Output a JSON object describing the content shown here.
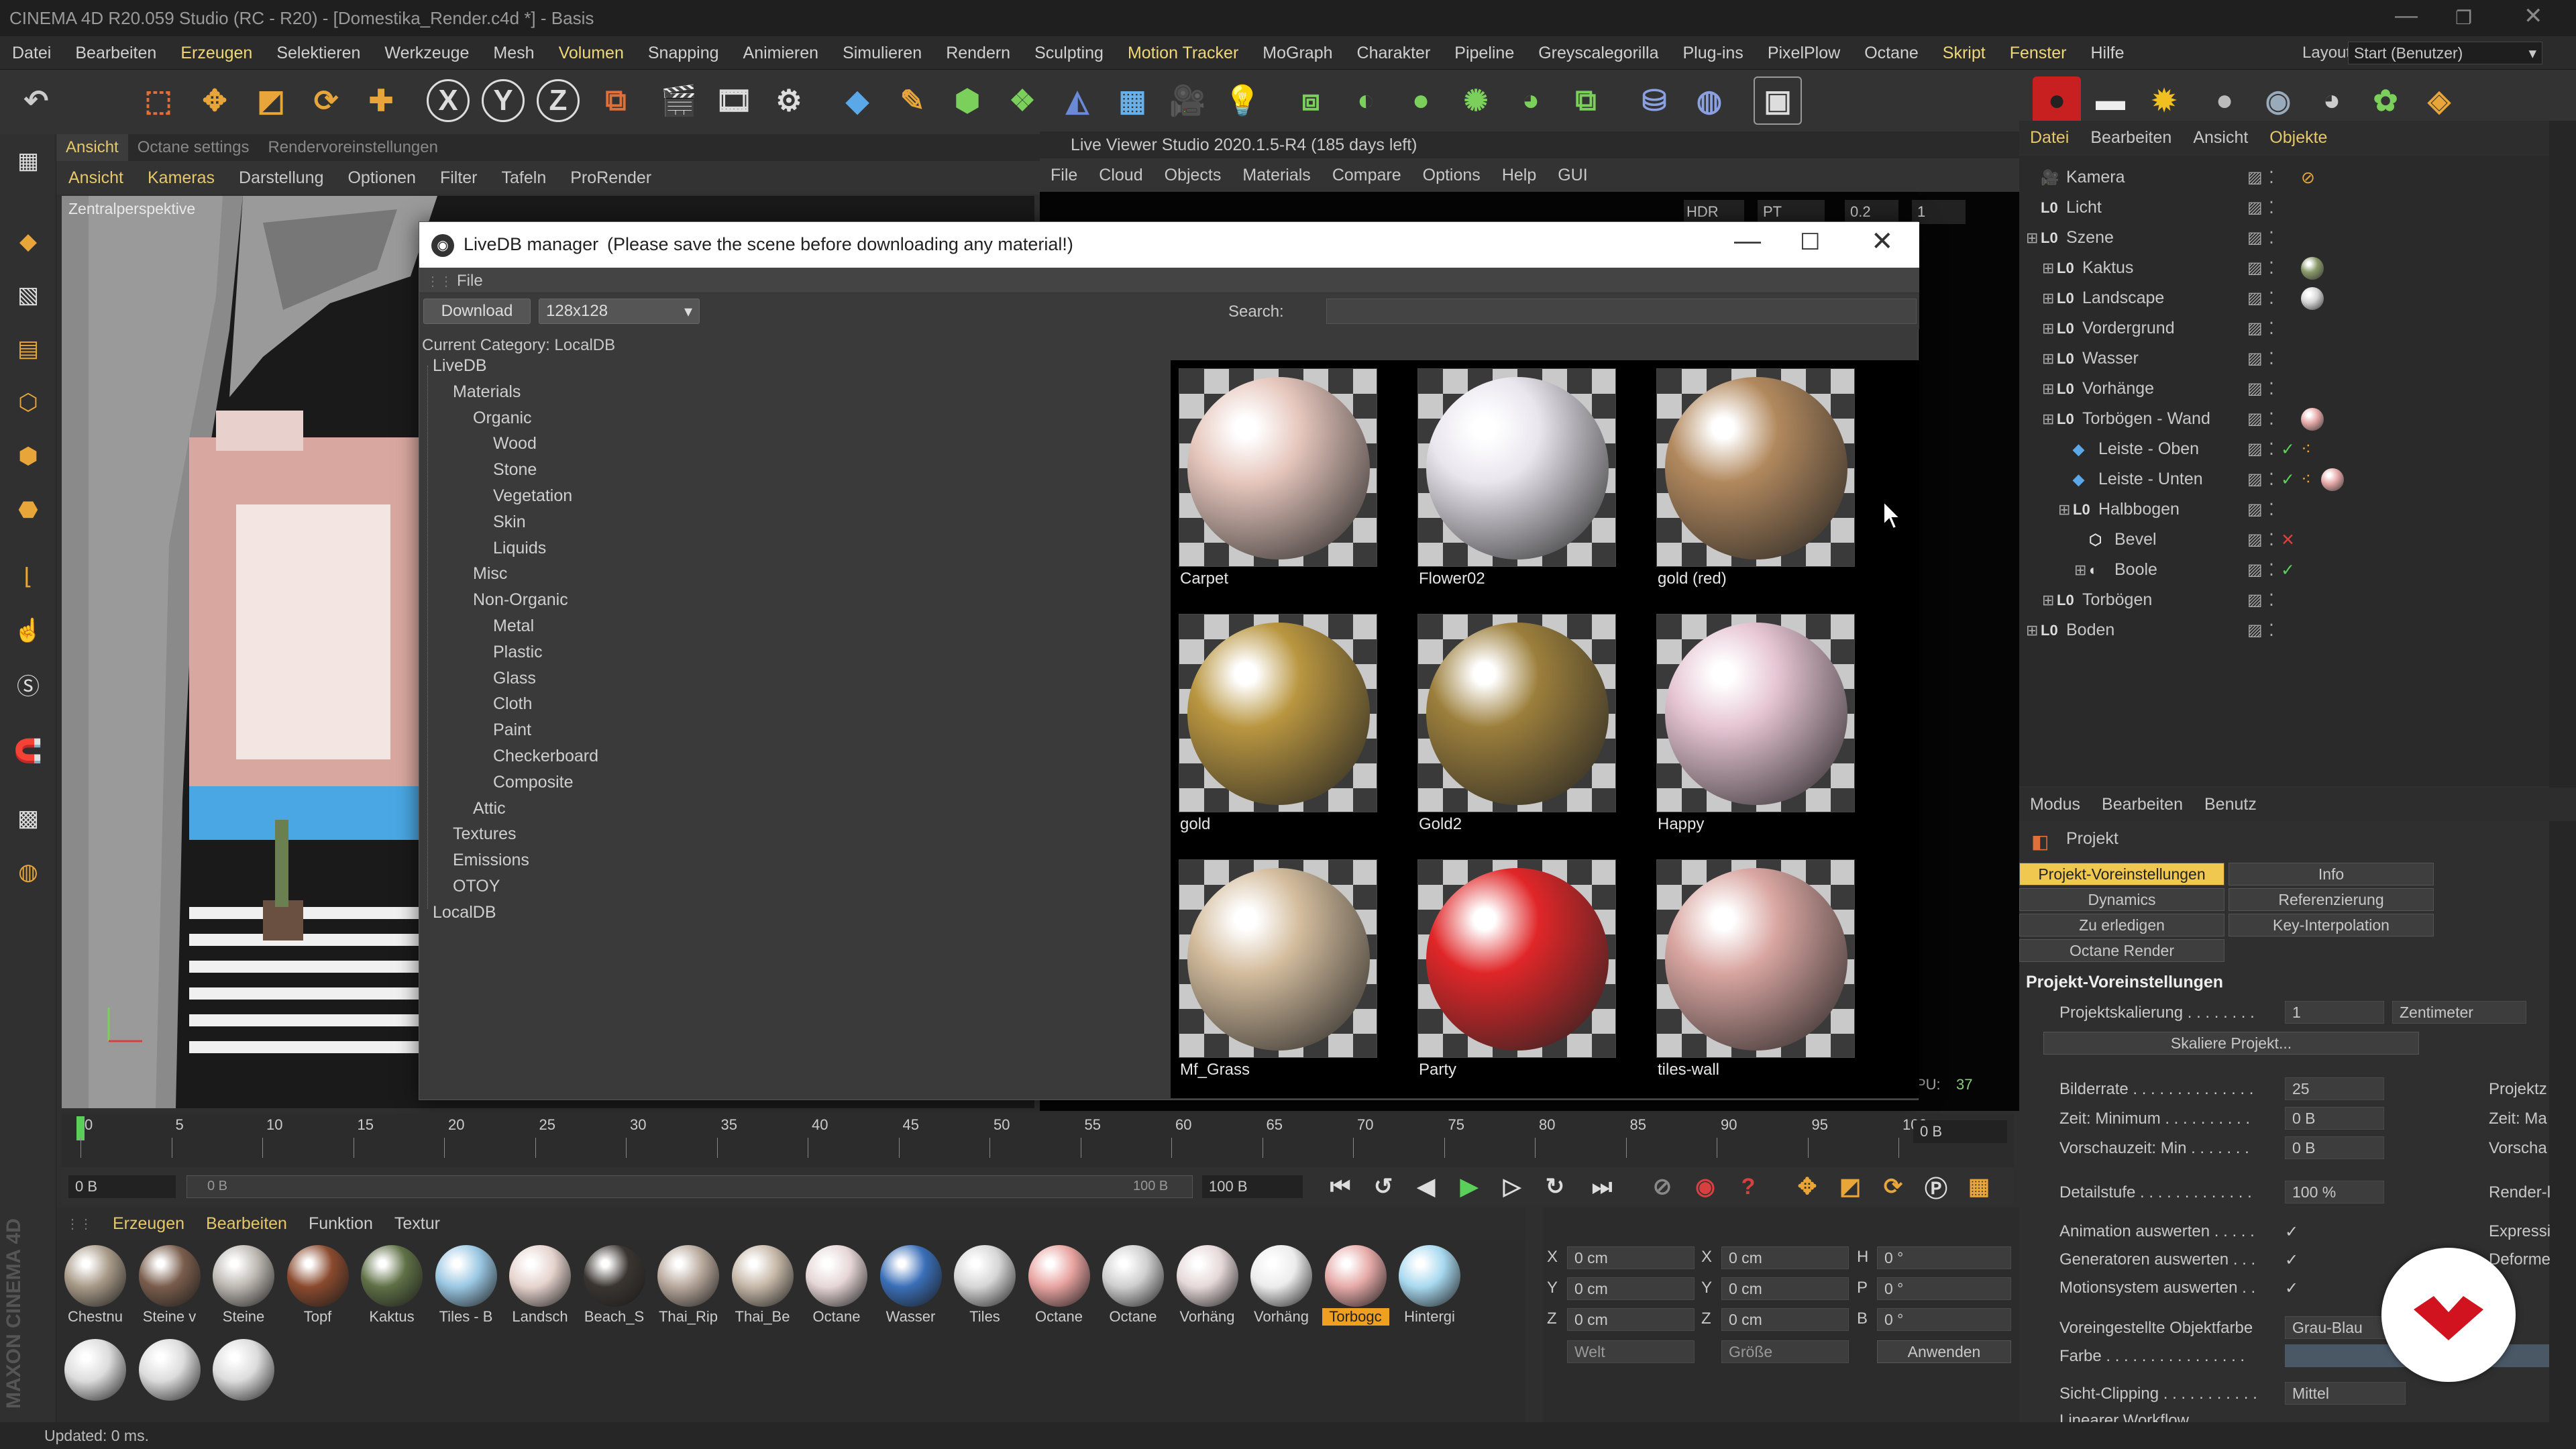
{
  "window": {
    "title": "CINEMA 4D R20.059 Studio (RC - R20) - [Domestika_Render.c4d *] - Basis",
    "layout_label": "Layout:",
    "layout_value": "Start (Benutzer)"
  },
  "menubar": [
    "Datei",
    "Bearbeiten",
    "Erzeugen",
    "Selektieren",
    "Werkzeuge",
    "Mesh",
    "Volumen",
    "Snapping",
    "Animieren",
    "Simulieren",
    "Rendern",
    "Sculpting",
    "Motion Tracker",
    "MoGraph",
    "Charakter",
    "Pipeline",
    "Greyscalegorilla",
    "Plug-ins",
    "PixelPlow",
    "Octane",
    "Skript",
    "Fenster",
    "Hilfe"
  ],
  "toolbar": {
    "x": "X",
    "y": "Y",
    "z": "Z"
  },
  "viewport": {
    "tabs": [
      "Ansicht",
      "Octane settings",
      "Rendervoreinstellungen"
    ],
    "menu": [
      "Ansicht",
      "Kameras",
      "Darstellung",
      "Optionen",
      "Filter",
      "Tafeln",
      "ProRender"
    ],
    "label": "Zentralperspektive"
  },
  "live_viewer": {
    "title": "Live Viewer Studio 2020.1.5-R4 (185 days left)",
    "menu": [
      "File",
      "Cloud",
      "Objects",
      "Materials",
      "Compare",
      "Options",
      "Help",
      "GUI"
    ],
    "hdr": "HDR tone",
    "pt": "PT",
    "zoom": "0.2",
    "num": "1",
    "pu_label": "PU:",
    "pu_value": "37"
  },
  "dialog": {
    "title": "LiveDB manager",
    "subtitle": "(Please save the scene before downloading any material!)",
    "file_menu": "File",
    "download": "Download",
    "size": "128x128",
    "search_label": "Search:",
    "category": "Current Category: LocalDB",
    "tree": [
      "LiveDB",
      "Materials",
      "Organic",
      "Wood",
      "Stone",
      "Vegetation",
      "Skin",
      "Liquids",
      "Misc",
      "Non-Organic",
      "Metal",
      "Plastic",
      "Glass",
      "Cloth",
      "Paint",
      "Checkerboard",
      "Composite",
      "Attic",
      "Textures",
      "Emissions",
      "OTOY",
      "LocalDB"
    ],
    "materials": [
      {
        "name": "Carpet",
        "color": "#e6c7bd"
      },
      {
        "name": "Flower02",
        "color": "#e9e6ee"
      },
      {
        "name": "gold (red)",
        "color": "#b2895e"
      },
      {
        "name": "gold",
        "color": "#b99640"
      },
      {
        "name": "Gold2",
        "color": "#9c7f3c"
      },
      {
        "name": "Happy",
        "color": "#e6c5d3"
      },
      {
        "name": "Mf_Grass",
        "color": "#d4bd9e"
      },
      {
        "name": "Party",
        "color": "#e02628"
      },
      {
        "name": "tiles-wall",
        "color": "#d9a6a1"
      }
    ]
  },
  "objects": {
    "tabs": [
      "Datei",
      "Bearbeiten",
      "Ansicht",
      "Objekte"
    ],
    "items": [
      {
        "name": "Kamera"
      },
      {
        "name": "Licht"
      },
      {
        "name": "Szene"
      },
      {
        "name": "Kaktus"
      },
      {
        "name": "Landscape"
      },
      {
        "name": "Vordergrund"
      },
      {
        "name": "Wasser"
      },
      {
        "name": "Vorhänge"
      },
      {
        "name": "Torbögen - Wand"
      },
      {
        "name": "Leiste - Oben"
      },
      {
        "name": "Leiste - Unten"
      },
      {
        "name": "Halbbogen"
      },
      {
        "name": "Bevel"
      },
      {
        "name": "Boole"
      },
      {
        "name": "Torbögen"
      },
      {
        "name": "Boden"
      }
    ]
  },
  "attributes": {
    "tabs": [
      "Modus",
      "Bearbeiten",
      "Benutz"
    ],
    "header": "Projekt",
    "buttons": [
      "Projekt-Voreinstellungen",
      "Info",
      "Dynamics",
      "Referenzierung",
      "Zu erledigen",
      "Key-Interpolation",
      "Octane Render"
    ],
    "section": "Projekt-Voreinstellungen",
    "scale_label": "Projektskalierung . . . . . . . .",
    "scale_value": "1",
    "scale_unit": "Zentimeter",
    "scale_button": "Skaliere Projekt...",
    "fields": [
      {
        "label": "Bilderrate . . . . . . . . . . . . . .",
        "value": "25",
        "right": "Projektz"
      },
      {
        "label": "Zeit: Minimum . . . . . . . . . .",
        "value": "0 B",
        "right": "Zeit: Ma"
      },
      {
        "label": "Vorschauzeit: Min . . . . . . .",
        "value": "0 B",
        "right": "Vorscha"
      },
      {
        "label": "Detailstufe . . . . . . . . . . . . .",
        "value": "100 %",
        "right": "Render-l"
      }
    ],
    "checks": [
      {
        "label": "Animation auswerten . . . . .",
        "right": "Expressi"
      },
      {
        "label": "Generatoren auswerten . . .",
        "right": "Deforme"
      },
      {
        "label": "Motionsystem auswerten . ."
      }
    ],
    "color_label": "Voreingestellte Objektfarbe",
    "color_value": "Grau-Blau",
    "farbe": "Farbe . . . . . . . . . . . . . . . .",
    "clip_label": "Sicht-Clipping . . . . . . . . . . .",
    "clip_value": "Mittel",
    "linear": "Linearer Workflow"
  },
  "timeline": {
    "ticks": [
      "0",
      "5",
      "10",
      "15",
      "20",
      "25",
      "30",
      "35",
      "40",
      "45",
      "50",
      "55",
      "60",
      "65",
      "70",
      "75",
      "80",
      "85",
      "90",
      "95",
      "100"
    ],
    "end_field": "0 B"
  },
  "transport": {
    "start": "0 B",
    "range_start": "0 B",
    "range_end": "100 B",
    "end": "100 B"
  },
  "materials_manager": {
    "menu": [
      "Erzeugen",
      "Bearbeiten",
      "Funktion",
      "Textur"
    ],
    "items": [
      {
        "name": "Chestnu",
        "color": "#a89a88"
      },
      {
        "name": "Steine v",
        "color": "#7a5d4c"
      },
      {
        "name": "Steine",
        "color": "#bdb8b2"
      },
      {
        "name": "Topf",
        "color": "#8a4a2e"
      },
      {
        "name": "Kaktus",
        "color": "#5f7046"
      },
      {
        "name": "Tiles - B",
        "color": "#9ac7e3"
      },
      {
        "name": "Landsch",
        "color": "#e6d3cd"
      },
      {
        "name": "Beach_S",
        "color": "#3a3530"
      },
      {
        "name": "Thai_Rip",
        "color": "#b8a89c"
      },
      {
        "name": "Thai_Be",
        "color": "#c6b8a8"
      },
      {
        "name": "Octane",
        "color": "#e6d6d6"
      },
      {
        "name": "Wasser",
        "color": "#3a6fb8"
      },
      {
        "name": "Tiles",
        "color": "#d6d6d6"
      },
      {
        "name": "Octane",
        "color": "#e8a3a0"
      },
      {
        "name": "Octane",
        "color": "#cfcfcf"
      },
      {
        "name": "Vorhäng",
        "color": "#e6d8d8"
      },
      {
        "name": "Vorhäng",
        "color": "#ececec"
      },
      {
        "name": "Torbogc",
        "color": "#e6aaa8"
      },
      {
        "name": "Hintergi",
        "color": "#a8d9f0"
      }
    ],
    "row2_count": 3
  },
  "coords": {
    "x": "X",
    "y": "Y",
    "z": "Z",
    "h": "H",
    "p": "P",
    "b": "B",
    "pos": "0 cm",
    "deg": "0 °",
    "welt": "Welt",
    "groesse": "Größe",
    "apply": "Anwenden"
  },
  "status": "Updated: 0 ms.",
  "brand": "MAXON CINEMA 4D"
}
